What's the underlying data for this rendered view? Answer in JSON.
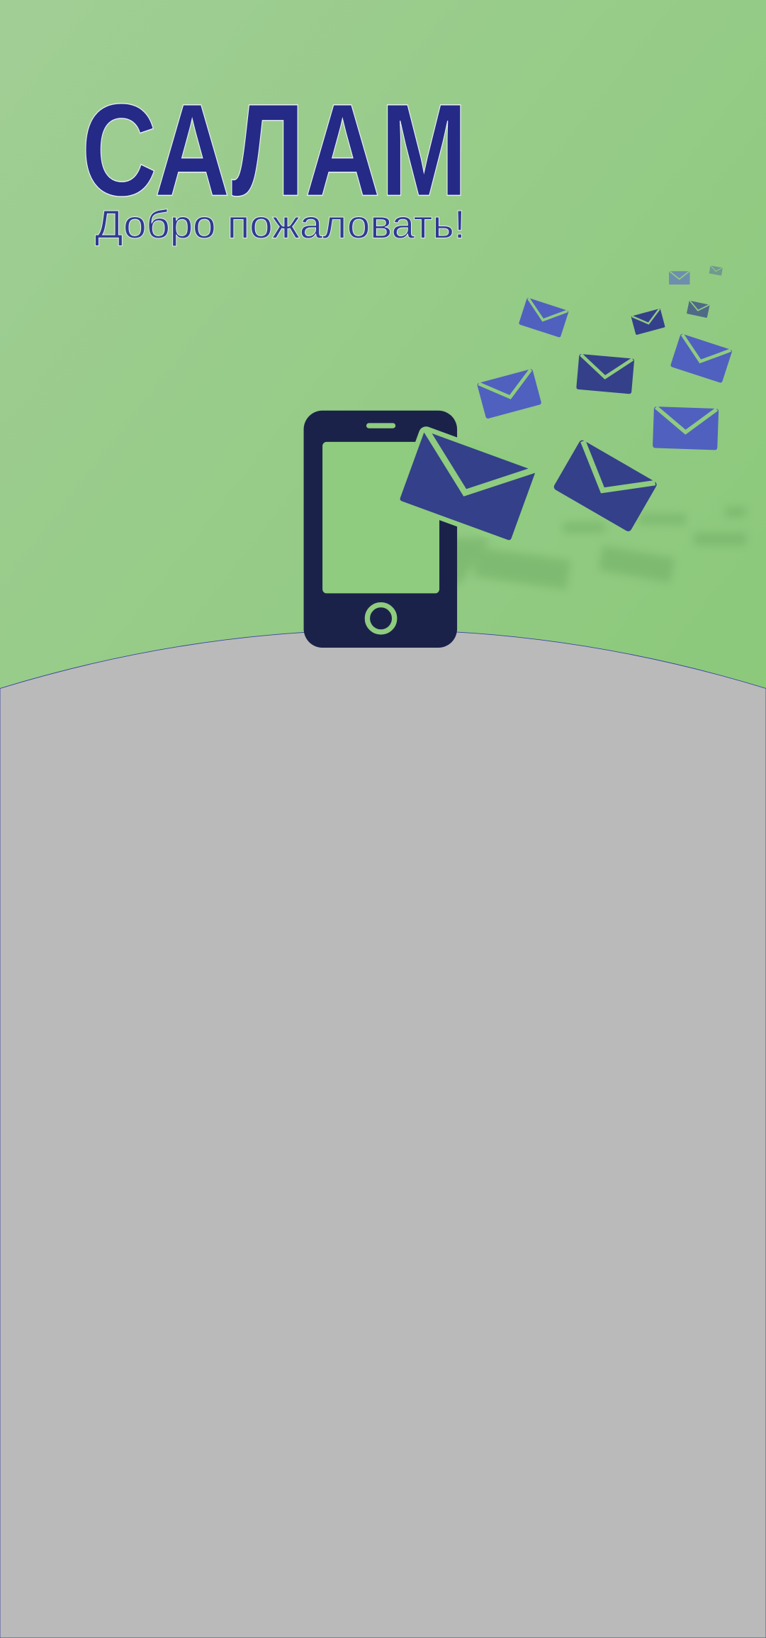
{
  "splash": {
    "title": "САЛАМ",
    "subtitle": "Добро пожаловать!"
  },
  "icons": {
    "hero": "phone-sending-mail-icon",
    "envelope": "envelope-icon"
  },
  "colors": {
    "background_top": "#a1ce95",
    "background_bottom": "#84c772",
    "lower_area": "#bababa",
    "title": "#242a86",
    "phone": "#1b2249",
    "envelope_dark": "#344089",
    "envelope_light": "#5060bf"
  }
}
